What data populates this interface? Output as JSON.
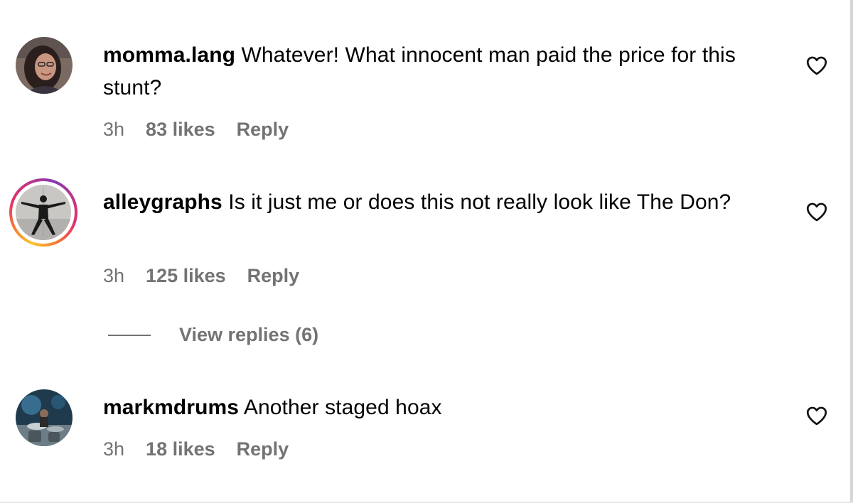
{
  "comments": [
    {
      "username": "momma.lang",
      "text": "Whatever! What innocent man paid the price for this stunt?",
      "time": "3h",
      "likes": "83 likes",
      "reply": "Reply",
      "avatar": "user-photo-woman",
      "has_story": false
    },
    {
      "username": "alleygraphs",
      "text": "Is it just me or does this not really look like The Don?",
      "time": "3h",
      "likes": "125 likes",
      "reply": "Reply",
      "avatar": "user-photo-figure",
      "has_story": true,
      "view_replies": "View replies (6)"
    },
    {
      "username": "markmdrums",
      "text": "Another staged hoax",
      "time": "3h",
      "likes": "18 likes",
      "reply": "Reply",
      "avatar": "user-photo-drummer",
      "has_story": false
    }
  ],
  "icons": {
    "like": "heart-outline-icon"
  },
  "colors": {
    "meta_text": "#737373",
    "story_ring_start": "#fdc530",
    "story_ring_end": "#c13584"
  }
}
